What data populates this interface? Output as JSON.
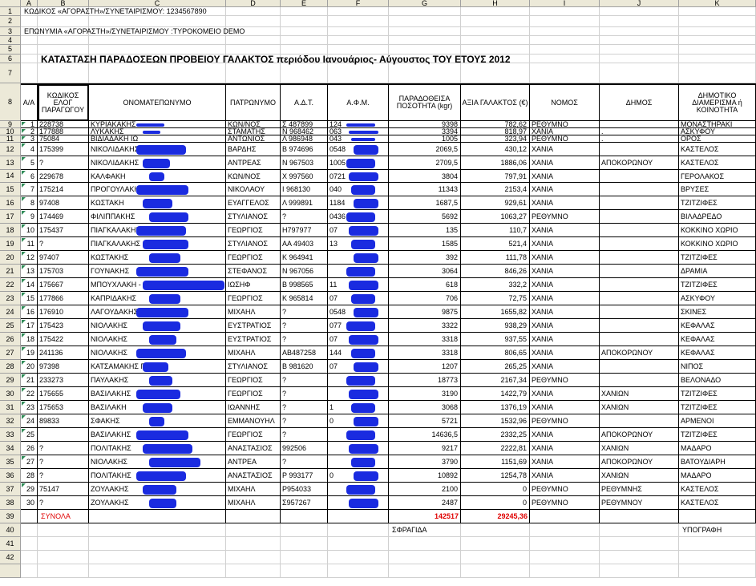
{
  "columns": [
    "A",
    "B",
    "C",
    "D",
    "E",
    "F",
    "G",
    "H",
    "I",
    "J",
    "K"
  ],
  "rows": [
    "1",
    "2",
    "3",
    "4",
    "5",
    "6",
    "7",
    "8",
    "9",
    "10",
    "11",
    "12",
    "13",
    "14",
    "15",
    "16",
    "17",
    "18",
    "19",
    "20",
    "21",
    "22",
    "23",
    "24",
    "25",
    "26",
    "27",
    "28",
    "29",
    "30",
    "31",
    "32",
    "33",
    "34",
    "35",
    "36",
    "37",
    "38",
    "39",
    "40",
    "41",
    "42"
  ],
  "top": {
    "buyer_code": "ΚΩΔΙΚΟΣ «ΑΓΟΡΑΣΤΗ»/ΣΥΝΕΤΑΙΡΙΣΜΟΥ: 1234567890",
    "buyer_name": "ΕΠΩΝΥΜΙΑ «ΑΓΟΡΑΣΤΗ»/ΣΥΝΕΤΑΙΡΙΣΜΟΥ :ΤΥΡΟΚΟΜΕΙΟ DEMO",
    "title": "ΚΑΤΑΣΤΑΣΗ ΠΑΡΑΔΟΣΕΩΝ ΠΡΟΒΕΙΟΥ ΓΑΛΑΚΤΟΣ περιόδου Ιανουάριος- Αύγουστος ΤΟΥ ΕΤΟΥΣ 2012"
  },
  "headers": [
    "Α/Α",
    "ΚΩΔΙΚΟΣ ΕΛΟΓ ΠΑΡΑΓΩΓΟΥ",
    "ΟΝΟΜΑΤΕΠΩΝΥΜΟ",
    "ΠΑΤΡΩΝΥΜΟ",
    "Α.Δ.Τ.",
    "Α.Φ.Μ.",
    "ΠΑΡΑΔΟΘΕΙΣΑ ΠΟΣΟΤΗΤΑ (kgr)",
    "ΑΞΙΑ ΓΑΛΑΚΤΟΣ (€)",
    "ΝΟΜΟΣ",
    "ΔΗΜΟΣ",
    "ΔΗΜΟΤΙΚΟ ΔΙΑΜΕΡΙΣΜΑ ή ΚΟΙΝΟΤΗΤΑ"
  ],
  "data_rows": [
    [
      "1",
      "228738",
      "ΚΥΡΙΑΚΑΚΗΣ",
      "ΚΩΝ/ΝΟΣ",
      "Σ 487899",
      "124",
      "9398",
      "782,62",
      "ΡΕΘΥΜΝΟ",
      "",
      "ΜΟΝΑΣΤΗΡΑΚΙ"
    ],
    [
      "2",
      "177888",
      "ΛΥΚΑΚΗΣ",
      "ΣΤΑΜΑΤΗΣ",
      "Ν 968462",
      "063",
      "3394",
      "818,97",
      "ΧΑΝΙΑ",
      ".",
      "ΑΣΚΥΦΟΥ"
    ],
    [
      "3",
      "75084",
      "ΒΙΔΙΑΔΑΚΗ ΙΩ",
      "ΑΝΤΩΝΙΟΣ",
      "Λ 986948",
      "043",
      "1005",
      "323,94",
      "ΡΕΘΥΜΝΟ",
      ".",
      "ΟΡΟΣ"
    ],
    [
      "4",
      "175399",
      "ΝΙΚΟΛΙΔΑΚΗΣ ΑΝ",
      "ΒΑΡΔΗΣ",
      "Β 974696",
      "0548",
      "2069,5",
      "430,12",
      "ΧΑΝΙΑ",
      "",
      "ΚΑΣΤΕΛΟΣ"
    ],
    [
      "5",
      "?",
      "ΝΙΚΟΛΙΔΑΚΗΣ",
      "ΑΝΤΡΕΑΣ",
      "Ν 967503",
      "1005",
      "2709,5",
      "1886,06",
      "ΧΑΝΙΑ",
      "ΑΠΟΚΟΡΩΝΟΥ",
      "ΚΑΣΤΕΛΟΣ"
    ],
    [
      "6",
      "229678",
      "ΚΑΛΦΑΚΗ",
      "ΚΩΝ/ΝΟΣ",
      "Χ 997560",
      "0721",
      "3804",
      "797,91",
      "ΧΑΝΙΑ",
      "",
      "ΓΕΡΟΛΑΚΟΣ"
    ],
    [
      "7",
      "175214",
      "ΠΡΟΓΟΥΛΑΚΗΣ",
      "ΝΙΚΟΛΑΟΥ",
      "Ι 968130",
      "040",
      "11343",
      "2153,4",
      "ΧΑΝΙΑ",
      "",
      "ΒΡΥΣΕΣ"
    ],
    [
      "8",
      "97408",
      "ΚΩΣΤΑΚΗ",
      "ΕΥΑΓΓΕΛΟΣ",
      "Λ 999891",
      "1184",
      "1687,5",
      "929,61",
      "ΧΑΝΙΑ",
      "",
      "ΤΖΙΤΖΙΦΕΣ"
    ],
    [
      "9",
      "174469",
      "ΦΙΛΙΠΠΑΚΗΣ",
      "ΣΤΥΛΙΑΝΟΣ",
      "?",
      "0436",
      "5692",
      "1063,27",
      "ΡΕΘΥΜΝΟ",
      "",
      "ΒΙΛΑΔΡΕΔΟ"
    ],
    [
      "10",
      "175437",
      "ΠΙΑΓΚΑΛΑΚΗΣ",
      "ΓΕΩΡΓΙΟΣ",
      "Η797977",
      "07",
      "135",
      "110,7",
      "ΧΑΝΙΑ",
      "",
      "ΚΟΚΚΙΝΟ ΧΩΡΙΟ"
    ],
    [
      "11",
      "?",
      "ΠΙΑΓΚΑΛΑΚΗΣ",
      "ΣΤΥΛΙΑΝΟΣ",
      "ΑΑ 49403",
      "13",
      "1585",
      "521,4",
      "ΧΑΝΙΑ",
      "",
      "ΚΟΚΚΙΝΟ ΧΩΡΙΟ"
    ],
    [
      "12",
      "97407",
      "ΚΩΣΤΑΚΗΣ",
      "ΓΕΩΡΓΙΟΣ",
      "Κ 964941",
      "",
      "392",
      "111,78",
      "ΧΑΝΙΑ",
      "",
      "ΤΖΙΤΖΙΦΕΣ"
    ],
    [
      "13",
      "175703",
      "ΓΟΥΝΑΚΗΣ",
      "ΣΤΕΦΑΝΟΣ",
      "Ν 967056",
      "",
      "3064",
      "846,26",
      "ΧΑΝΙΑ",
      "",
      "ΔΡΑΜΙΑ"
    ],
    [
      "14",
      "175667",
      "ΜΠΟΥΧΛΑΚΗ -",
      "ΙΩΣΗΦ",
      "Β 998565",
      "11",
      "618",
      "332,2",
      "ΧΑΝΙΑ",
      "",
      "ΤΖΙΤΖΙΦΕΣ"
    ],
    [
      "15",
      "177866",
      "ΚΑΠΡΙΔΑΚΗΣ",
      "ΓΕΩΡΓΙΟΣ",
      "Κ 965814",
      "07",
      "706",
      "72,75",
      "ΧΑΝΙΑ",
      "",
      "ΑΣΚΥΦΟΥ"
    ],
    [
      "16",
      "176910",
      "ΛΑΓΟΥΔΑΚΗΣ",
      "ΜΙΧΑΗΛ",
      "?",
      "0548",
      "9875",
      "1655,82",
      "ΧΑΝΙΑ",
      "",
      "ΣΚΙΝΕΣ"
    ],
    [
      "17",
      "175423",
      "ΝΙΟΛΑΚΗΣ",
      "ΕΥΣΤΡΑΤΙΟΣ",
      "?",
      "077",
      "3322",
      "938,29",
      "ΧΑΝΙΑ",
      "",
      "ΚΕΦΑΛΑΣ"
    ],
    [
      "18",
      "175422",
      "ΝΙΟΛΑΚΗΣ",
      "ΕΥΣΤΡΑΤΙΟΣ",
      "?",
      "07",
      "3318",
      "937,55",
      "ΧΑΝΙΑ",
      "",
      "ΚΕΦΑΛΑΣ"
    ],
    [
      "19",
      "241136",
      "ΝΙΟΛΑΚΗΣ",
      "ΜΙΧΑΗΛ",
      "ΑΒ487258",
      "144",
      "3318",
      "806,65",
      "ΧΑΝΙΑ",
      "ΑΠΟΚΟΡΩΝΟΥ",
      "ΚΕΦΑΛΑΣ"
    ],
    [
      "20",
      "97398",
      "ΚΑΤΣΑΜΑΚΗΣ Γ",
      "ΣΤΥΛΙΑΝΟΣ",
      "Β 981620",
      "07",
      "1207",
      "265,25",
      "ΧΑΝΙΑ",
      "",
      "ΝΙΠΟΣ"
    ],
    [
      "21",
      "233273",
      "ΠΑΥΛΑΚΗΣ",
      "ΓΕΩΡΓΙΟΣ",
      "?",
      "",
      "18773",
      "2167,34",
      "ΡΕΘΥΜΝΟ",
      "",
      "ΒΕΛΟΝΑΔΟ"
    ],
    [
      "22",
      "175655",
      "ΒΑΣΙΛΑΚΗΣ",
      "ΓΕΩΡΓΙΟΣ",
      "?",
      "",
      "3190",
      "1422,79",
      "ΧΑΝΙΑ",
      "ΧΑΝΙΩΝ",
      "ΤΖΙΤΖΙΦΕΣ"
    ],
    [
      "23",
      "175653",
      "ΒΑΣΙΛΑΚΗ",
      "ΙΩΑΝΝΗΣ",
      "?",
      "1",
      "3068",
      "1376,19",
      "ΧΑΝΙΑ",
      "ΧΑΝΙΩΝ",
      "ΤΖΙΤΖΙΦΕΣ"
    ],
    [
      "24",
      "89833",
      "ΣΦΑΚΗΣ",
      "ΕΜΜΑΝΟΥΗΛ",
      "?",
      "0",
      "5721",
      "1532,96",
      "ΡΕΘΥΜΝΟ",
      "",
      "ΑΡΜΕΝΟΙ"
    ],
    [
      "25",
      "",
      "ΒΑΣΙΛΑΚΗΣ",
      "ΓΕΩΡΓΙΟΣ",
      "?",
      "",
      "14636,5",
      "2332,25",
      "ΧΑΝΙΑ",
      "ΑΠΟΚΟΡΩΝΟΥ",
      "ΤΖΙΤΖΙΦΕΣ"
    ],
    [
      "26",
      "?",
      "ΠΟΛΙΤΑΚΗΣ",
      "ΑΝΑΣΤΑΣΙΟΣ",
      "992506",
      "",
      "9217",
      "2222,81",
      "ΧΑΝΙΑ",
      "ΧΑΝΙΩΝ",
      "ΜΑΔΑΡΟ"
    ],
    [
      "27",
      "?",
      "ΝΙΟΛΑΚΗΣ",
      "ΑΝΤΡΕΑ",
      "?",
      "",
      "3790",
      "1151,69",
      "ΧΑΝΙΑ",
      "ΑΠΟΚΟΡΩΝΟΥ",
      "ΒΑΤΟΥΔΙΑΡΗ"
    ],
    [
      "28",
      "?",
      "ΠΟΛΙΤΑΚΗΣ",
      "ΑΝΑΣΤΑΣΙΟΣ",
      "Ρ 993177",
      "0",
      "10892",
      "1254,78",
      "ΧΑΝΙΑ",
      "ΧΑΝΙΩΝ",
      "ΜΑΔΑΡΟ"
    ],
    [
      "29",
      "75147",
      "ΖΟΥΛΑΚΗΣ",
      "ΜΙΧΑΗΛ",
      "Ρ954033",
      "",
      "2100",
      "0",
      "ΡΕΘΥΜΝΟ",
      "ΡΕΘΥΜΝΗΣ",
      "ΚΑΣΤΕΛΟΣ"
    ],
    [
      "30",
      "?",
      "ΖΟΥΛΑΚΗΣ",
      "ΜΙΧΑΗΛ",
      "Σ957267",
      "",
      "2487",
      "0",
      "ΡΕΘΥΜΝΟ",
      "ΡΕΘΥΜΝΟΥ",
      "ΚΑΣΤΕΛΟΣ"
    ]
  ],
  "totals": {
    "label": "ΣΥΝΟΛΑ",
    "quantity": "142517",
    "value": "29245,36"
  },
  "footer": {
    "stamp": "ΣΦΡΑΓΙΔΑ",
    "signature": "ΥΠΟΓΡΑΦΗ"
  }
}
